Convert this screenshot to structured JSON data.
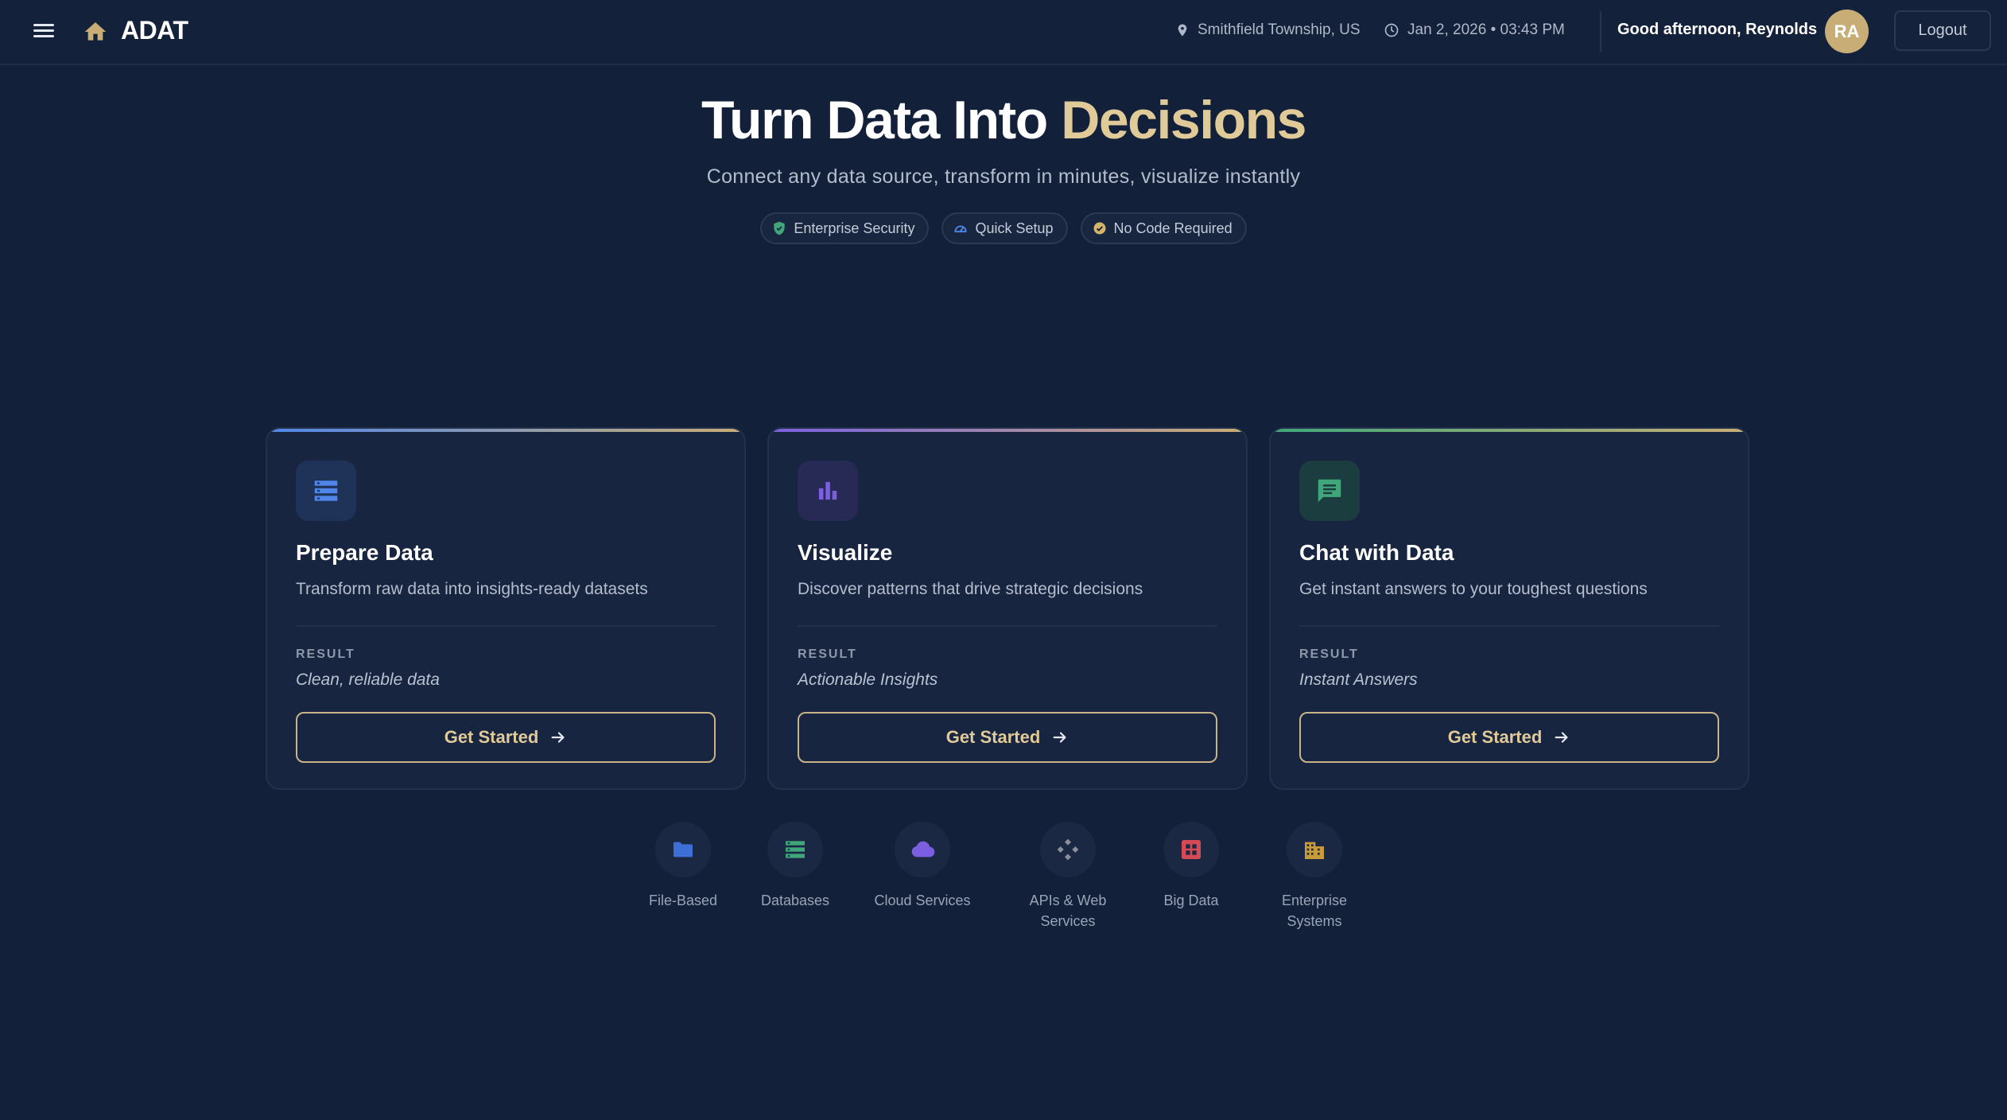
{
  "header": {
    "brand": "ADAT",
    "location": "Smithfield Township, US",
    "datetime": "Jan 2, 2026 • 03:43 PM",
    "greeting": "Good afternoon, Reynolds",
    "avatar_initials": "RA",
    "logout_label": "Logout"
  },
  "hero": {
    "title_main": "Turn Data Into ",
    "title_accent": "Decisions",
    "subtitle": "Connect any data source, transform in minutes, visualize instantly",
    "pills": [
      {
        "label": "Enterprise Security",
        "icon": "shield-icon"
      },
      {
        "label": "Quick Setup",
        "icon": "speedometer-icon"
      },
      {
        "label": "No Code Required",
        "icon": "check-circle-icon"
      }
    ]
  },
  "cards": [
    {
      "title": "Prepare Data",
      "description": "Transform raw data into insights-ready datasets",
      "result_label": "RESULT",
      "result_value": "Clean, reliable data",
      "cta": "Get Started",
      "icon": "storage-icon",
      "accent": "#4f86e8"
    },
    {
      "title": "Visualize",
      "description": "Discover patterns that drive strategic decisions",
      "result_label": "RESULT",
      "result_value": "Actionable Insights",
      "cta": "Get Started",
      "icon": "bar-chart-icon",
      "accent": "#7b5fe0"
    },
    {
      "title": "Chat with Data",
      "description": "Get instant answers to your toughest questions",
      "result_label": "RESULT",
      "result_value": "Instant Answers",
      "cta": "Get Started",
      "icon": "chat-icon",
      "accent": "#3fa77a"
    }
  ],
  "sources": [
    {
      "label": "File-Based",
      "icon": "folder-icon",
      "color": "#3d6fd6"
    },
    {
      "label": "Databases",
      "icon": "database-icon",
      "color": "#3fa77a"
    },
    {
      "label": "Cloud Services",
      "icon": "cloud-icon",
      "color": "#7b5fe0"
    },
    {
      "label": "APIs & Web Services",
      "icon": "api-icon",
      "color": "#8a8f98"
    },
    {
      "label": "Big Data",
      "icon": "grid-icon",
      "color": "#d44a55"
    },
    {
      "label": "Enterprise Systems",
      "icon": "building-icon",
      "color": "#c79a3a"
    }
  ],
  "colors": {
    "background": "#13203a",
    "gold_accent": "#dfca98",
    "card_bg": "#182541"
  }
}
